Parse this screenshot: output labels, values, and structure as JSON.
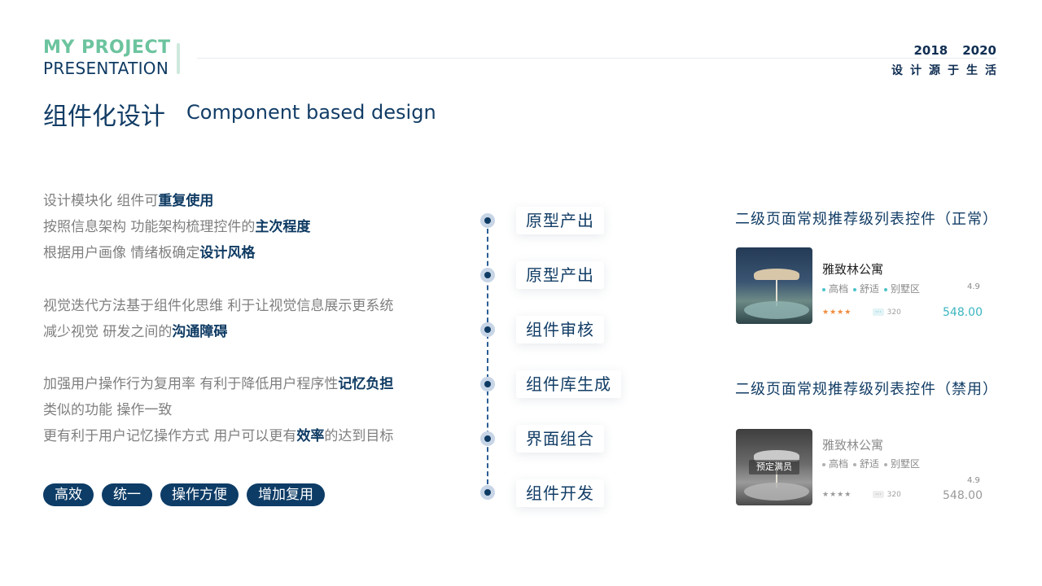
{
  "header": {
    "brand_top": "MY PROJECT",
    "brand_bottom": "PRESENTATION",
    "year_start": "2018",
    "year_end": "2020",
    "tagline": "设计源于生活",
    "title": "组件化设计",
    "subtitle": "Component based design"
  },
  "left": {
    "p1": [
      {
        "plain": "设计模块化 组件可",
        "hl": "重复使用"
      },
      {
        "plain": "按照信息架构 功能架构梳理控件的",
        "hl": "主次程度"
      },
      {
        "plain": "根据用户画像 情绪板确定",
        "hl": "设计风格"
      }
    ],
    "p2": [
      {
        "plain": "视觉迭代方法基于组件化思维 利于让视觉信息展示更系统",
        "hl": ""
      },
      {
        "plain": "减少视觉 研发之间的",
        "hl": "沟通障碍"
      }
    ],
    "p3": [
      {
        "plain": "加强用户操作行为复用率 有利于降低用户程序性",
        "hl": "记忆负担"
      },
      {
        "plain": "类似的功能 操作一致",
        "hl": ""
      },
      {
        "plain": "更有利于用户记忆操作方式 用户可以更有",
        "hl": "效率",
        "after": "的达到目标"
      }
    ],
    "tags": [
      "高效",
      "统一",
      "操作方便",
      "增加复用"
    ]
  },
  "timeline": {
    "steps": [
      "原型产出",
      "原型产出",
      "组件审核",
      "组件库生成",
      "界面组合",
      "组件开发"
    ]
  },
  "cards": {
    "normal": {
      "section_title": "二级页面常规推荐级列表控件（正常）",
      "name": "雅致林公寓",
      "features": [
        "高档",
        "舒适",
        "别墅区"
      ],
      "rating": "4.9",
      "stars": "★★★★",
      "count_chip": "···",
      "count": "320",
      "price": "548.00"
    },
    "disabled": {
      "section_title": "二级页面常规推荐级列表控件（禁用）",
      "badge": "预定满员",
      "name": "雅致林公寓",
      "features": [
        "高档",
        "舒适",
        "别墅区"
      ],
      "rating": "4.9",
      "stars": "★★★★",
      "count_chip": "···",
      "count": "320",
      "price": "548.00"
    }
  },
  "colors": {
    "brand_green": "#6cc49e",
    "navy": "#0f3b63",
    "text_gray": "#7f7f7f",
    "price_teal": "#3ab5c0",
    "star_orange": "#f08a3c"
  }
}
